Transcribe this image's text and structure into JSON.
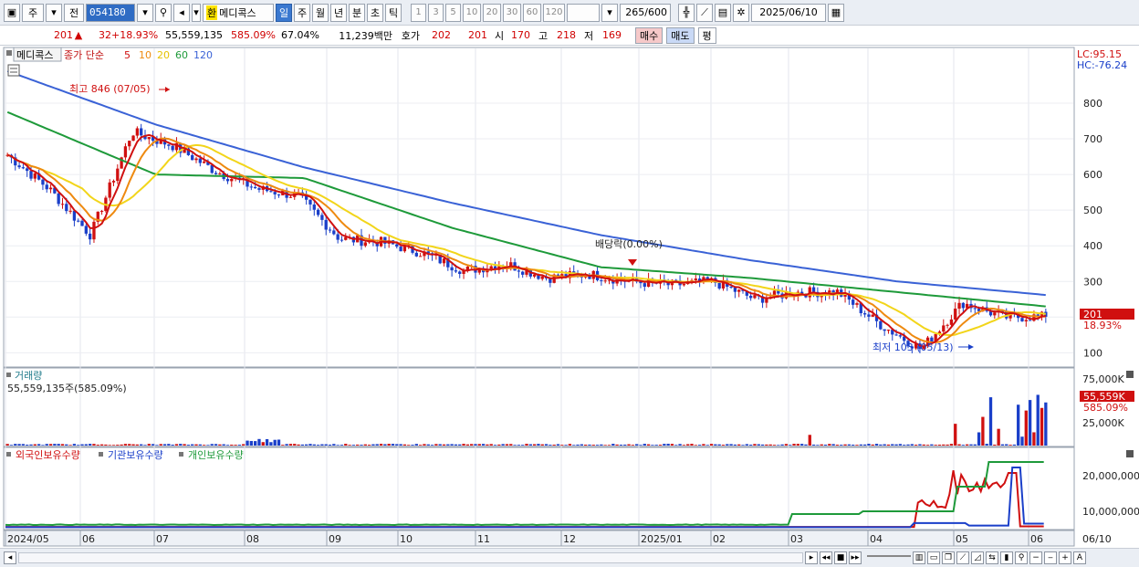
{
  "toolbar": {
    "market_label": "주",
    "currency_label": "전",
    "stock_code": "054180",
    "stock_name_badge": "환",
    "stock_name": "메디콕스",
    "periods": [
      "일",
      "주",
      "월",
      "년",
      "분",
      "초",
      "틱"
    ],
    "active_period": "일",
    "minute_options": [
      "1",
      "3",
      "5",
      "10",
      "20",
      "30",
      "60",
      "120"
    ],
    "data_count": "265/600",
    "date": "2025/06/10"
  },
  "quote": {
    "price": "201",
    "change": "32",
    "change_pct": "+18.93%",
    "volume": "55,559,135",
    "volume_ratio": "585.09%",
    "turnover": "67.04%",
    "amount": "11,239백만",
    "label_hoga": "호가",
    "hoga_ask": "202",
    "hoga_bid": "201",
    "label_open": "시",
    "open": "170",
    "label_high": "고",
    "high": "218",
    "label_low": "저",
    "low": "169",
    "buy_button": "매수",
    "sell_button": "매도",
    "eval_button": "평"
  },
  "price_panel": {
    "stock_label": "메디콕스",
    "ma_title": "종가 단순",
    "ma_periods": [
      "5",
      "10",
      "20",
      "60",
      "120"
    ],
    "lc_label": "LC:95.15",
    "hc_label": "HC:-76.24",
    "high_annotation": "최고 846 (07/05)",
    "low_annotation": "최저 103 (05/13)",
    "dividend_annotation": "배당락(0.00%)",
    "last_price_tag": "201",
    "last_change_tag": "18.93%",
    "y_ticks": [
      "800",
      "700",
      "600",
      "500",
      "400",
      "300",
      "100"
    ]
  },
  "volume_panel": {
    "title": "거래량",
    "value_label": "55,559,135주(585.09%)",
    "y_ticks": [
      "75,000K",
      "25,000K"
    ],
    "last_tag": "55,559K",
    "last_ratio": "585.09%"
  },
  "holding_panel": {
    "legend": [
      "외국인보유수량",
      "기관보유수량",
      "개인보유수량"
    ],
    "y_ticks": [
      "20,000,000",
      "10,000,000"
    ]
  },
  "x_axis": {
    "labels": [
      "2024/05",
      "06",
      "07",
      "08",
      "09",
      "10",
      "11",
      "12",
      "2025/01",
      "02",
      "03",
      "04",
      "05",
      "06"
    ],
    "right_label": "06/10"
  },
  "colors": {
    "ma5": "#d01010",
    "ma10": "#ee8a10",
    "ma20": "#f2d51a",
    "ma60": "#1e9a3a",
    "ma120": "#3a62d6",
    "up": "#d01010",
    "down": "#1a3fc9"
  },
  "chart_data": {
    "type": "candlestick-with-volume",
    "x_range": [
      "2024/05",
      "2025/06/10"
    ],
    "price_ylim": [
      60,
      910
    ],
    "high": {
      "value": 846,
      "date": "07/05"
    },
    "low": {
      "value": 103,
      "date": "05/13"
    },
    "last": {
      "close": 201,
      "change_pct": 18.93,
      "open": 170,
      "high": 218,
      "low": 169
    },
    "price_path": [
      {
        "x": "2024/05",
        "close": 655
      },
      {
        "x": "06",
        "close": 560
      },
      {
        "x": "06-end",
        "close": 430
      },
      {
        "x": "07",
        "close": 720
      },
      {
        "x": "07-mid",
        "close": 680
      },
      {
        "x": "08",
        "close": 610
      },
      {
        "x": "08-mid",
        "close": 560
      },
      {
        "x": "09",
        "close": 540
      },
      {
        "x": "09-end",
        "close": 420
      },
      {
        "x": "10",
        "close": 410
      },
      {
        "x": "10-end",
        "close": 380
      },
      {
        "x": "11",
        "close": 330
      },
      {
        "x": "12",
        "close": 350
      },
      {
        "x": "12-mid",
        "close": 310
      },
      {
        "x": "2025/01",
        "close": 320
      },
      {
        "x": "02",
        "close": 300
      },
      {
        "x": "02-end",
        "close": 290
      },
      {
        "x": "03",
        "close": 300
      },
      {
        "x": "03-mid",
        "close": 250
      },
      {
        "x": "04",
        "close": 270
      },
      {
        "x": "04-end",
        "close": 270
      },
      {
        "x": "05",
        "close": 180
      },
      {
        "x": "05-13",
        "close": 110
      },
      {
        "x": "05-end",
        "close": 240
      },
      {
        "x": "06",
        "close": 200
      },
      {
        "x": "06-10",
        "close": 201
      }
    ],
    "ma120_path": [
      {
        "x": "2024/05",
        "value": 890
      },
      {
        "x": "07",
        "value": 740
      },
      {
        "x": "09",
        "value": 620
      },
      {
        "x": "11",
        "value": 520
      },
      {
        "x": "2025/01",
        "value": 430
      },
      {
        "x": "03",
        "value": 360
      },
      {
        "x": "05",
        "value": 300
      },
      {
        "x": "06-10",
        "value": 262
      }
    ],
    "ma60_path": [
      {
        "x": "2024/05",
        "value": 775
      },
      {
        "x": "07",
        "value": 600
      },
      {
        "x": "09",
        "value": 590
      },
      {
        "x": "11",
        "value": 450
      },
      {
        "x": "2025/01",
        "value": 340
      },
      {
        "x": "03",
        "value": 310
      },
      {
        "x": "05",
        "value": 270
      },
      {
        "x": "06-10",
        "value": 230
      }
    ],
    "volume_ylim_k": [
      0,
      80000
    ],
    "volume_last_k": 55559,
    "holdings_ylim": [
      0,
      25000000
    ]
  }
}
